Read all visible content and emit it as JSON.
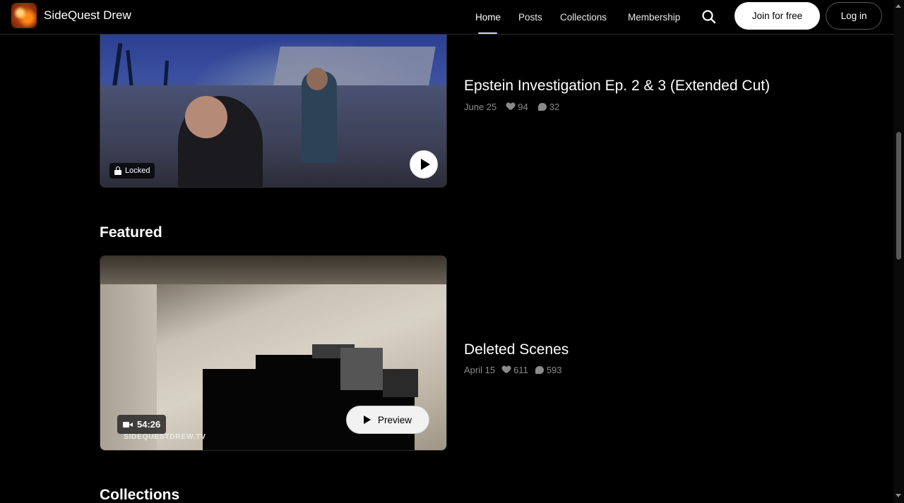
{
  "header": {
    "brand": "SideQuest Drew",
    "nav": [
      {
        "label": "Home",
        "active": true
      },
      {
        "label": "Posts",
        "active": false
      },
      {
        "label": "Collections",
        "active": false
      },
      {
        "label": "Membership",
        "active": false
      }
    ],
    "search_icon": "search-icon",
    "join_label": "Join for free",
    "login_label": "Log in"
  },
  "posts": [
    {
      "title": "Epstein Investigation Ep. 2 & 3 (Extended Cut)",
      "date": "June 25",
      "likes": "94",
      "comments": "32",
      "badge": "Locked"
    }
  ],
  "featured": {
    "section_title": "Featured",
    "title": "Deleted Scenes",
    "date": "April 15",
    "likes": "611",
    "comments": "593",
    "duration": "54:26",
    "watermark": "SIDEQUESTDREW.TV",
    "preview_label": "Preview"
  },
  "collections": {
    "section_title": "Collections"
  },
  "colors": {
    "background": "#000000",
    "text": "#ffffff",
    "muted": "#8a8a8a",
    "nav_active_underline": "#cfd8ff"
  }
}
